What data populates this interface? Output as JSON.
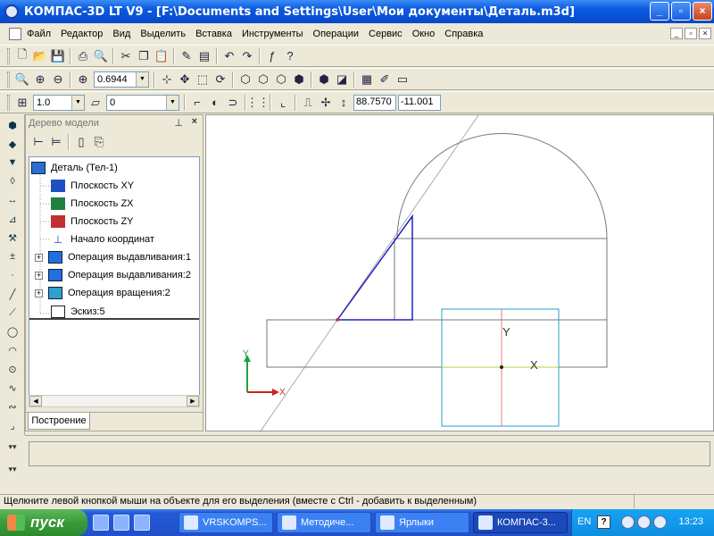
{
  "window": {
    "title": "КОМПАС-3D LT V9 - [F:\\Documents and Settings\\User\\Мои документы\\Деталь.m3d]",
    "controls": [
      "_",
      "▫",
      "×"
    ]
  },
  "menu": [
    "Файл",
    "Редактор",
    "Вид",
    "Выделить",
    "Вставка",
    "Инструменты",
    "Операции",
    "Сервис",
    "Окно",
    "Справка"
  ],
  "toolbar2": {
    "zoom": "0.6944"
  },
  "toolbar3": {
    "step": "1.0",
    "layer": "0",
    "coord_x": "88.7570",
    "coord_y": "-11.001"
  },
  "tree": {
    "title": "Дерево модели",
    "root": "Деталь (Тел-1)",
    "items": [
      {
        "label": "Плоскость XY",
        "icon": "plane-xy-icon",
        "color": "#2050c0"
      },
      {
        "label": "Плоскость ZX",
        "icon": "plane-zx-icon",
        "color": "#208040"
      },
      {
        "label": "Плоскость ZY",
        "icon": "plane-zy-icon",
        "color": "#c03030"
      },
      {
        "label": "Начало координат",
        "icon": "origin-icon"
      },
      {
        "label": "Операция выдавливания:1",
        "icon": "extrude-icon"
      },
      {
        "label": "Операция выдавливания:2",
        "icon": "extrude-icon"
      },
      {
        "label": "Операция вращения:2",
        "icon": "revolve-icon"
      },
      {
        "label": "Эскиз:5",
        "icon": "sketch-icon"
      }
    ],
    "tab": "Построение"
  },
  "canvas": {
    "axis_x": "X",
    "axis_y": "Y",
    "sketch_color": "#2020c0",
    "grid_box_color": "#2aa0c8"
  },
  "status": "Щелкните левой кнопкой мыши на объекте для его выделения (вместе с Ctrl - добавить к выделенным)",
  "taskbar": {
    "start": "пуск",
    "tasks": [
      "VRSKOMPS...",
      "Методиче...",
      "Ярлыки",
      "КОМПАС-3..."
    ],
    "lang": "EN",
    "time": "13:23"
  }
}
